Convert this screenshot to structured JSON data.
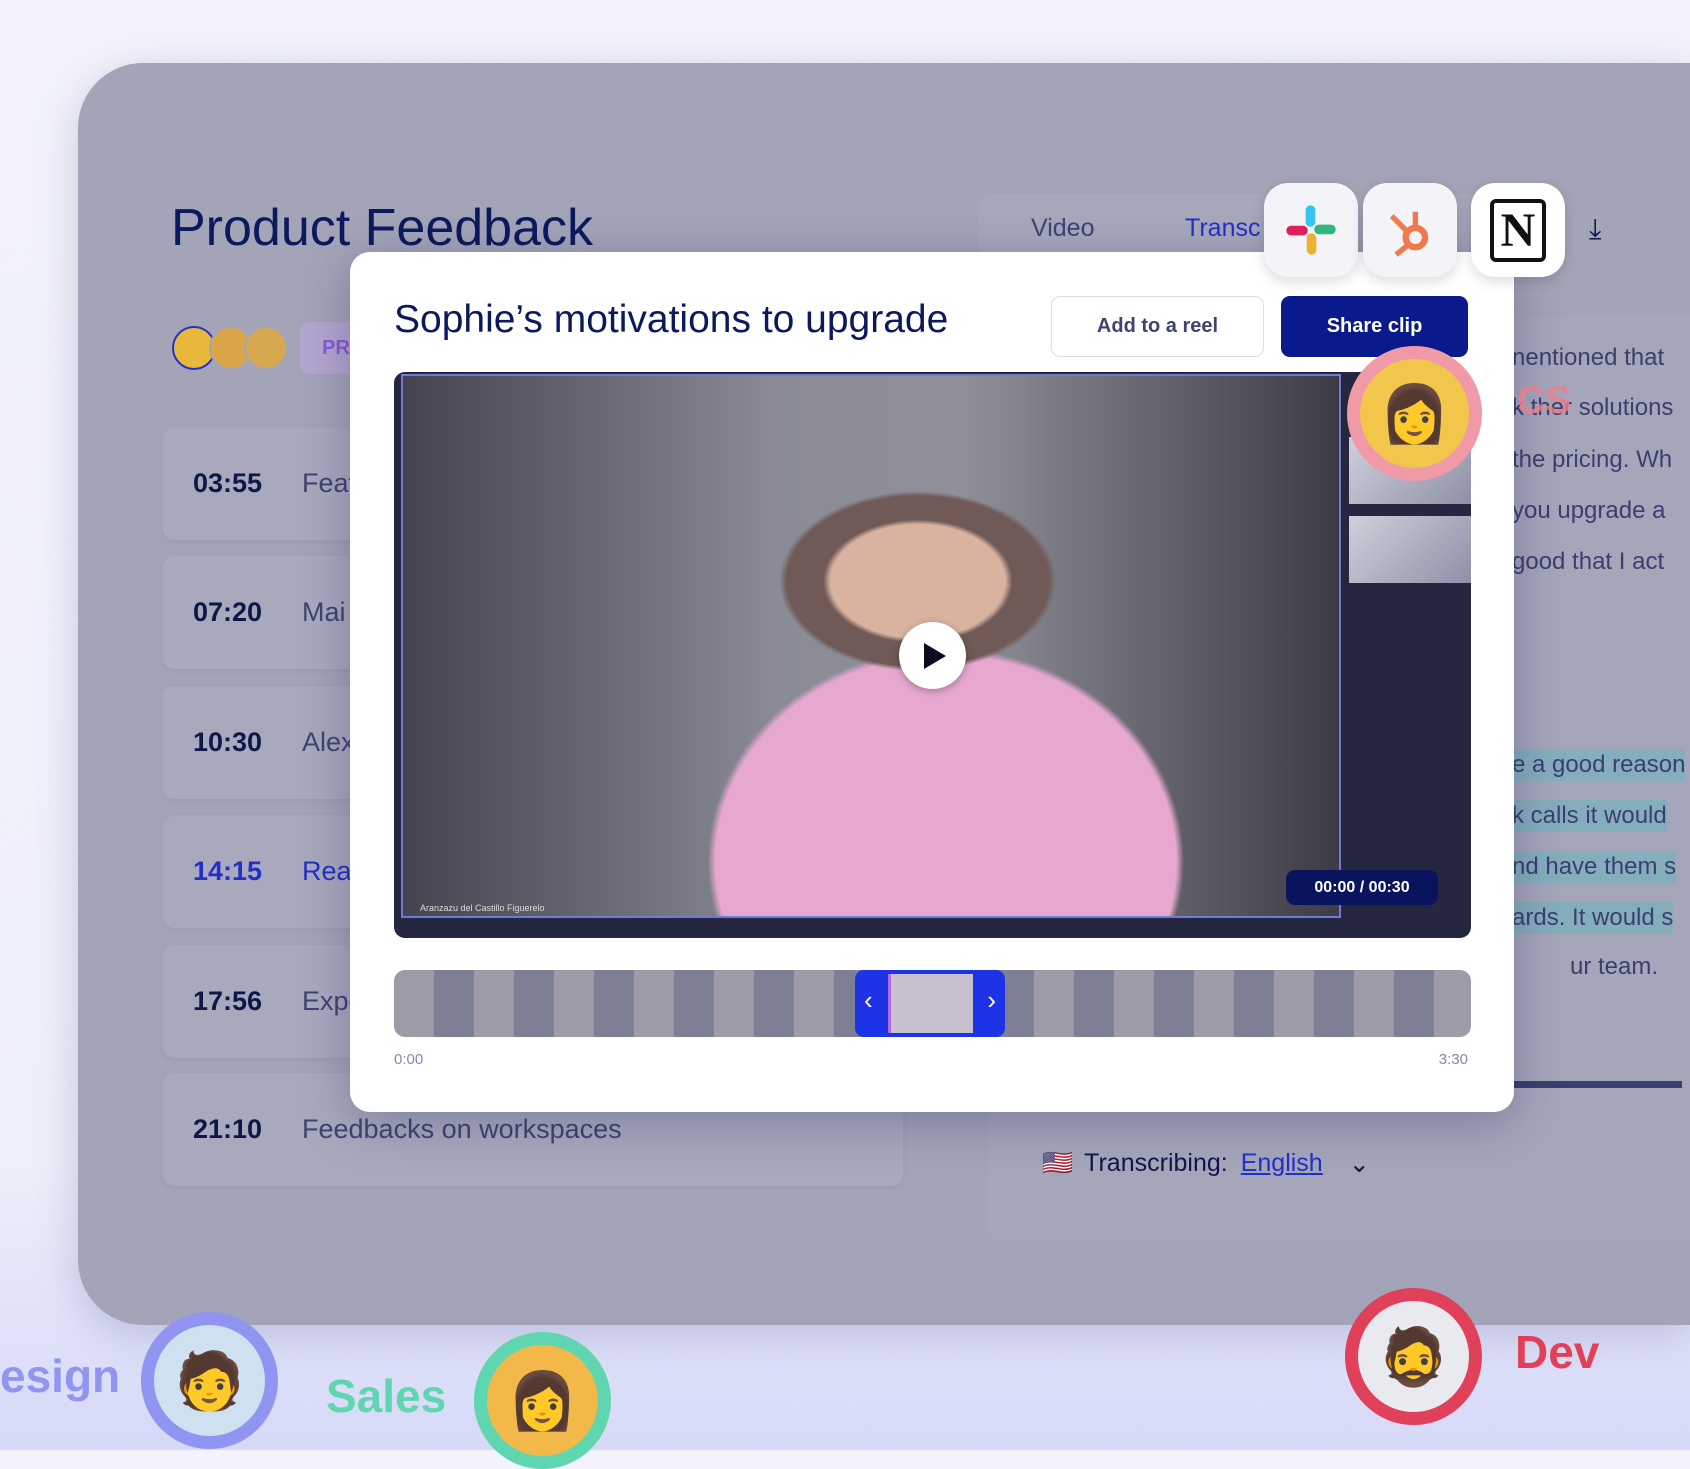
{
  "page": {
    "title": "Product Feedback",
    "tag": "PR"
  },
  "tabs": [
    {
      "label": "Video"
    },
    {
      "label": "Transc"
    }
  ],
  "chapters": [
    {
      "time": "03:55",
      "label": "Feat"
    },
    {
      "time": "07:20",
      "label": "Mai"
    },
    {
      "time": "10:30",
      "label": "Alex"
    },
    {
      "time": "14:15",
      "label": "Reas",
      "active": true
    },
    {
      "time": "17:56",
      "label": "Expe"
    },
    {
      "time": "21:10",
      "label": "Feedbacks on workspaces"
    }
  ],
  "transcript": {
    "lines": [
      "nentioned that",
      "k ther solutions",
      "the pricing. Wh",
      "you upgrade a",
      "good that I act"
    ],
    "highlighted": [
      "e a good reason",
      "k calls it would",
      "nd have them s",
      "ards. It would s"
    ],
    "tail": "ur team.",
    "transcribing_label": "Transcribing:",
    "language": "English",
    "flag": "🇺🇸"
  },
  "modal": {
    "title": "Sophie’s motivations to upgrade",
    "add_to_reel": "Add to a reel",
    "share_clip": "Share clip",
    "timecode": "00:00 / 00:30",
    "speaker_caption": "Aranzazu del Castillo Figuerelo",
    "timeline_start": "0:00",
    "timeline_end": "3:30"
  },
  "integrations": [
    {
      "name": "slack-icon"
    },
    {
      "name": "hubspot-icon"
    },
    {
      "name": "notion-icon",
      "glyph": "N"
    }
  ],
  "teams": {
    "design": "esign",
    "sales": "Sales",
    "dev": "Dev",
    "cs": "CS"
  },
  "colors": {
    "primary": "#0a1a8c",
    "accent": "#1f33e6",
    "sales": "#5fd6b0",
    "dev": "#e0405a",
    "design": "#8f95f0",
    "cs": "#f07d8a"
  }
}
